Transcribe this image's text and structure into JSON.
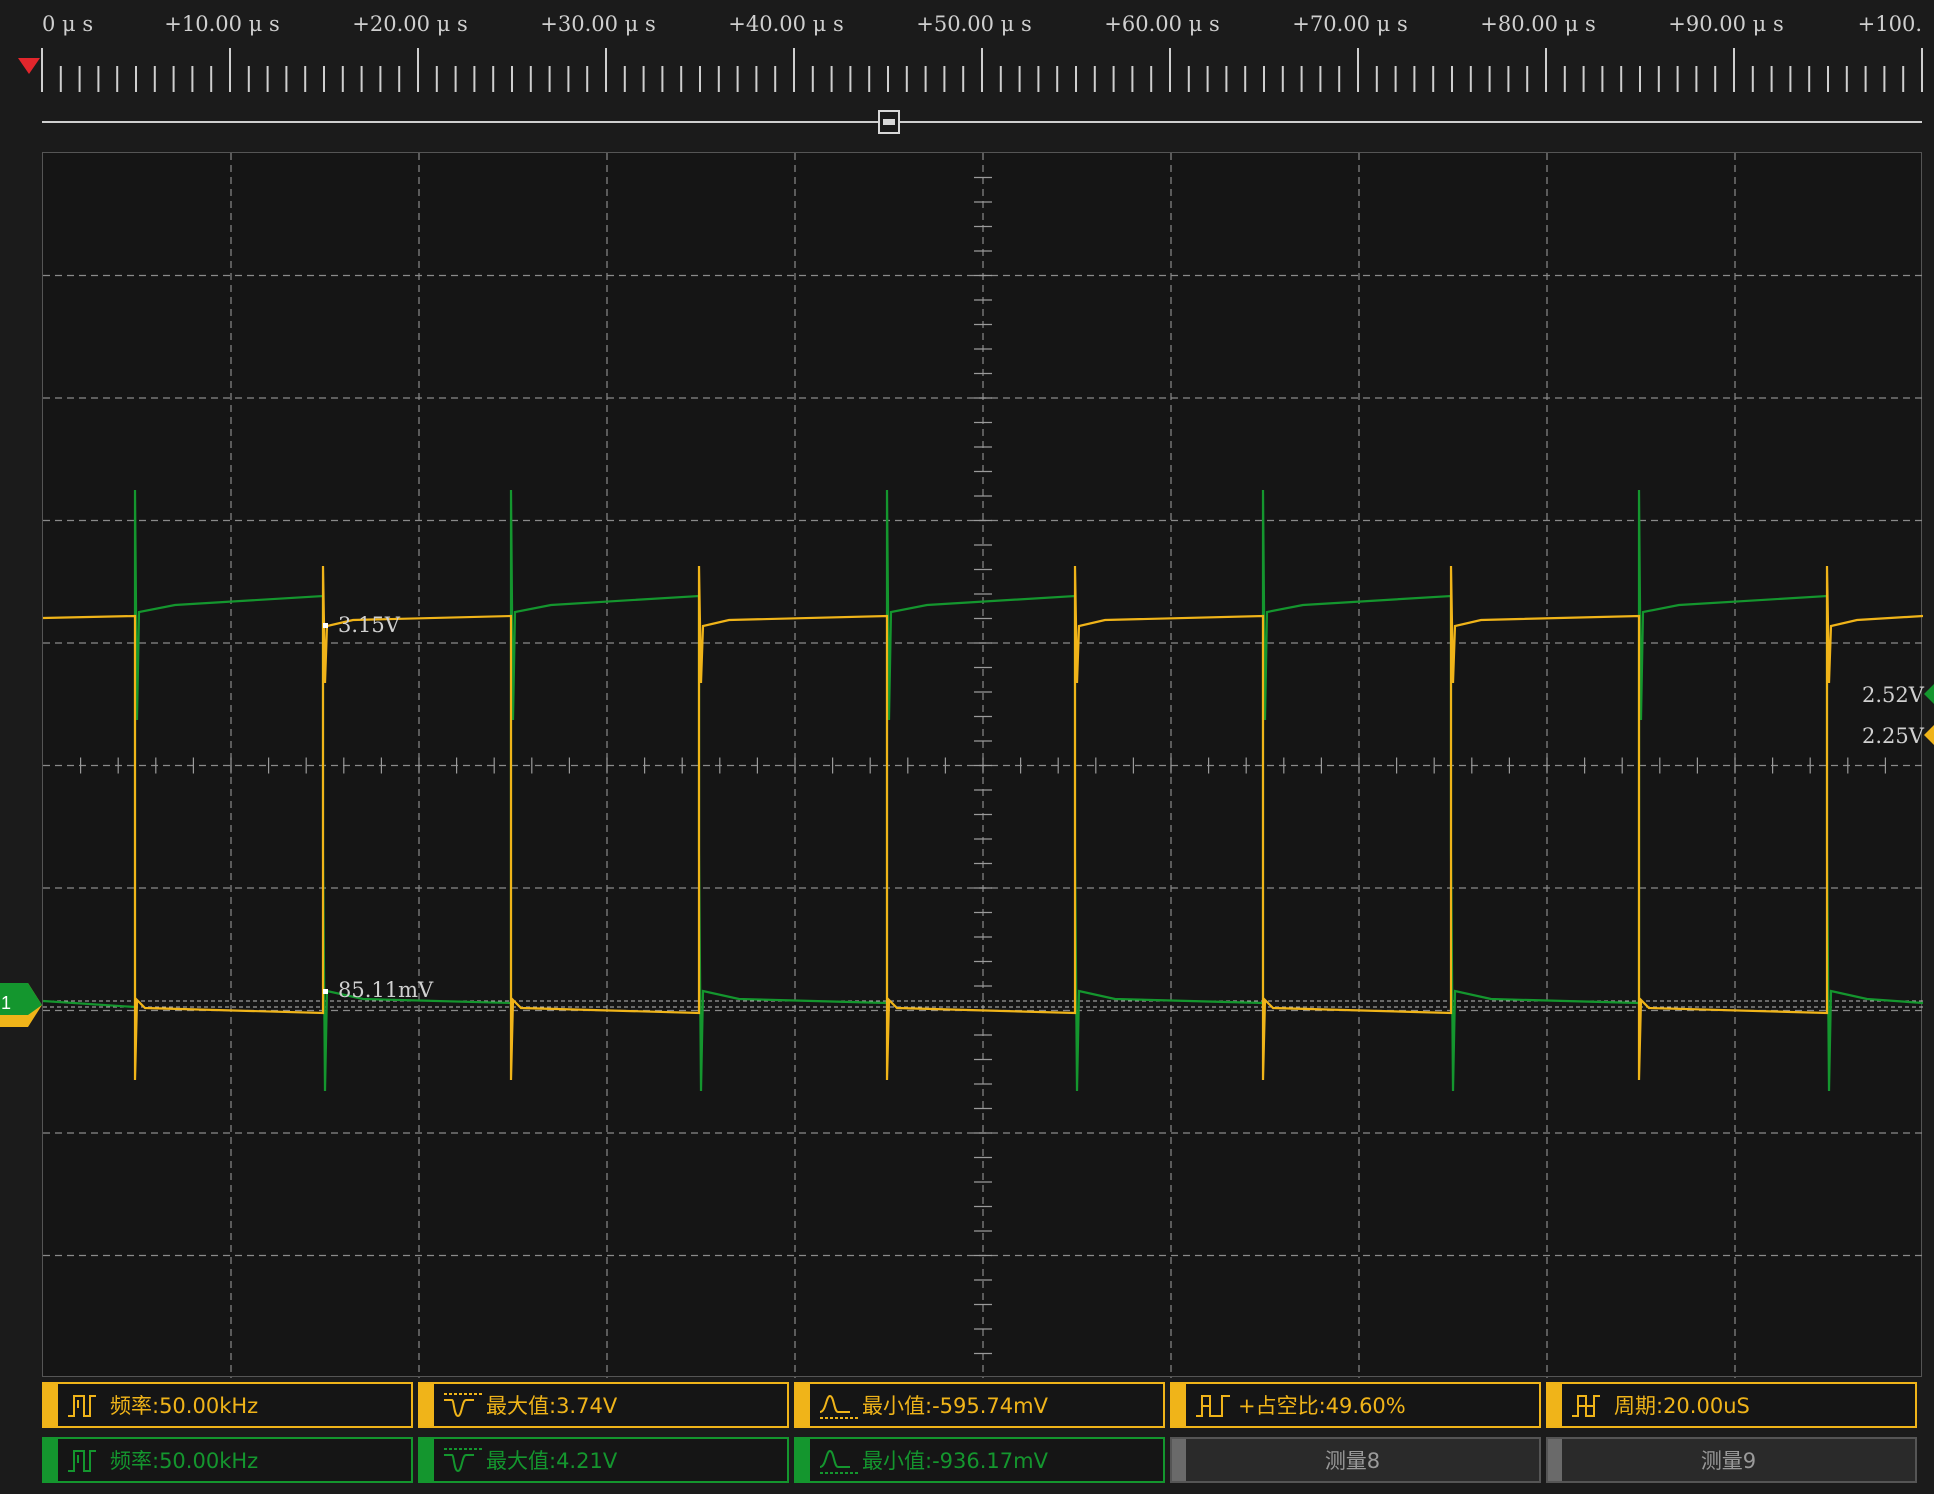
{
  "timebase": {
    "labels": [
      "0 μ s",
      "+10.00 μ s",
      "+20.00 μ s",
      "+30.00 μ s",
      "+40.00 μ s",
      "+50.00 μ s",
      "+60.00 μ s",
      "+70.00 μ s",
      "+80.00 μ s",
      "+90.00 μ s",
      "+100."
    ]
  },
  "waveform": {
    "cursor_ch1_high": "3.15V",
    "cursor_ch2_low": "85.11mV",
    "ch2_level": "2.52V",
    "ch1_level": "2.25V",
    "channel_marker": "1",
    "colors": {
      "ch1": "#f0b419",
      "ch2": "#14962e",
      "trigger": "#e2262c"
    }
  },
  "measurements": {
    "row1": [
      {
        "icon": "pulse-frequency-icon",
        "text": "频率:50.00kHz"
      },
      {
        "icon": "max-value-icon",
        "text": "最大值:3.74V"
      },
      {
        "icon": "min-value-icon",
        "text": "最小值:-595.74mV"
      },
      {
        "icon": "duty-cycle-icon",
        "text": "+占空比:49.60%"
      },
      {
        "icon": "period-icon",
        "text": "周期:20.00uS"
      }
    ],
    "row2": [
      {
        "icon": "pulse-frequency-icon",
        "text": "频率:50.00kHz"
      },
      {
        "icon": "max-value-icon",
        "text": "最大值:4.21V"
      },
      {
        "icon": "min-value-icon",
        "text": "最小值:-936.17mV"
      },
      {
        "text": "测量8"
      },
      {
        "text": "测量9"
      }
    ]
  }
}
